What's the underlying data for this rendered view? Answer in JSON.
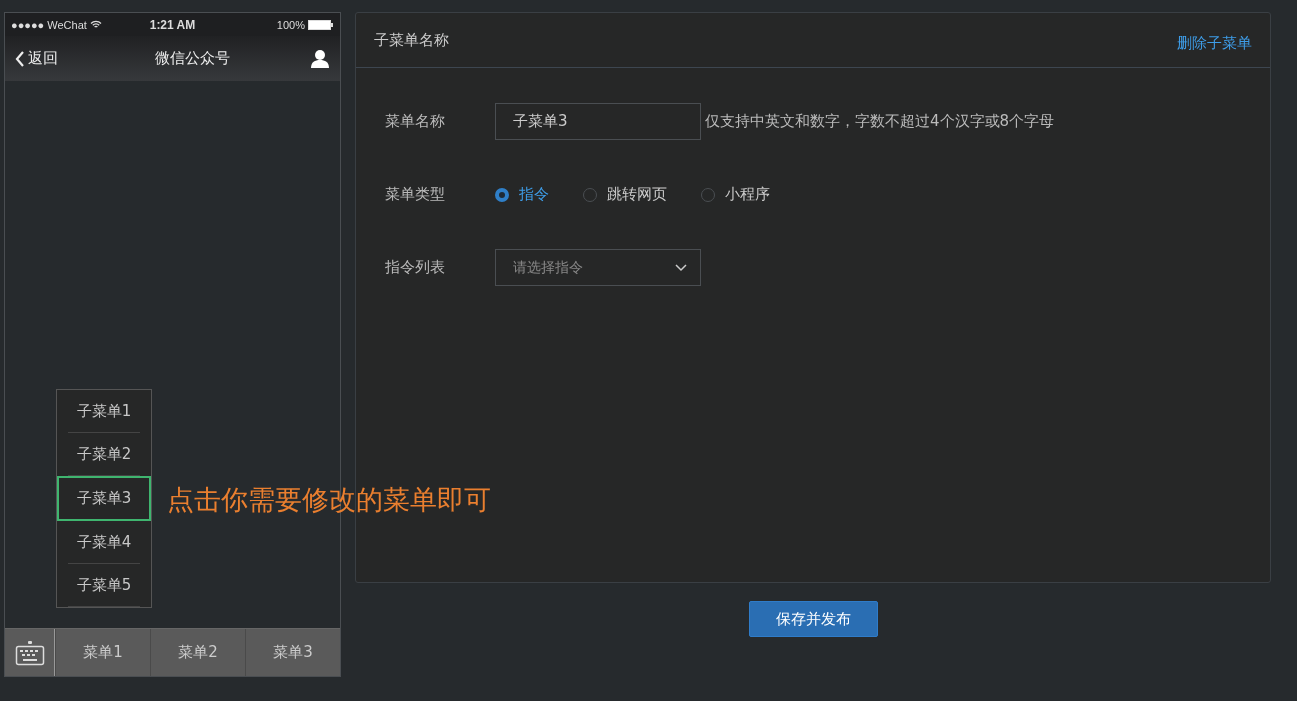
{
  "status_bar": {
    "carrier": "●●●●● WeChat",
    "time": "1:21 AM",
    "battery": "100%"
  },
  "nav_bar": {
    "back": "返回",
    "title": "微信公众号"
  },
  "submenu": [
    {
      "label": "子菜单1",
      "selected": false
    },
    {
      "label": "子菜单2",
      "selected": false
    },
    {
      "label": "子菜单3",
      "selected": true
    },
    {
      "label": "子菜单4",
      "selected": false
    },
    {
      "label": "子菜单5",
      "selected": false
    }
  ],
  "menu_bar": [
    {
      "label": "菜单1"
    },
    {
      "label": "菜单2"
    },
    {
      "label": "菜单3"
    }
  ],
  "hint_overlay": "点击你需要修改的菜单即可",
  "panel": {
    "title": "子菜单名称",
    "delete_link": "删除子菜单",
    "name_field": {
      "label": "菜单名称",
      "value": "子菜单3",
      "hint": "仅支持中英文和数字，字数不超过4个汉字或8个字母"
    },
    "type_field": {
      "label": "菜单类型",
      "options": [
        {
          "label": "指令",
          "selected": true
        },
        {
          "label": "跳转网页",
          "selected": false
        },
        {
          "label": "小程序",
          "selected": false
        }
      ]
    },
    "command_field": {
      "label": "指令列表",
      "placeholder": "请选择指令"
    }
  },
  "save_button": "保存并发布"
}
